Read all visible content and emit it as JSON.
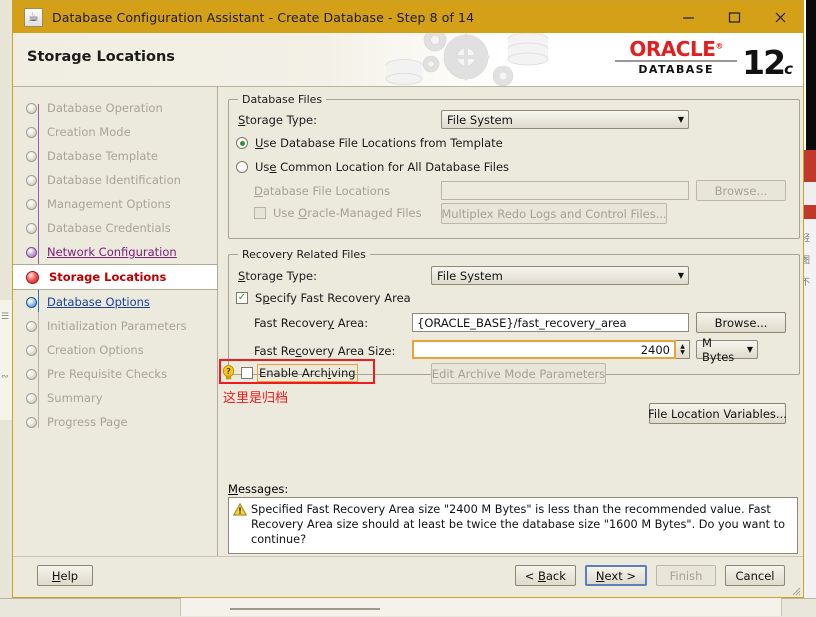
{
  "window": {
    "title": "Database Configuration Assistant - Create Database - Step 8 of 14",
    "app_icon": "java-coffee-cup-icon",
    "minimize_label": "─",
    "maximize_label": "□",
    "close_label": "✕"
  },
  "banner": {
    "page_title": "Storage Locations",
    "brand": "ORACLE",
    "brand_reg": "®",
    "brand_sub": "DATABASE",
    "version_number": "12",
    "version_suffix": "c"
  },
  "sidebar": {
    "items": [
      {
        "label": "Database Operation",
        "state": "pending"
      },
      {
        "label": "Creation Mode",
        "state": "pending"
      },
      {
        "label": "Database Template",
        "state": "pending"
      },
      {
        "label": "Database Identification",
        "state": "pending"
      },
      {
        "label": "Management Options",
        "state": "pending"
      },
      {
        "label": "Database Credentials",
        "state": "pending"
      },
      {
        "label": "Network Configuration",
        "state": "done"
      },
      {
        "label": "Storage Locations",
        "state": "current"
      },
      {
        "label": "Database Options",
        "state": "next"
      },
      {
        "label": "Initialization Parameters",
        "state": "pending"
      },
      {
        "label": "Creation Options",
        "state": "pending"
      },
      {
        "label": "Pre Requisite Checks",
        "state": "pending"
      },
      {
        "label": "Summary",
        "state": "pending"
      },
      {
        "label": "Progress Page",
        "state": "pending"
      }
    ]
  },
  "database_files": {
    "legend": "Database Files",
    "storage_type_label": "Storage Type:",
    "storage_type_value": "File System",
    "radio_template": "Use Database File Locations from Template",
    "radio_common": "Use Common Location for All Database Files",
    "file_locations_label": "Database File Locations",
    "file_locations_value": "",
    "browse_label": "Browse...",
    "omf_label": "Use Oracle-Managed Files",
    "multiplex_label": "Multiplex Redo Logs and Control Files..."
  },
  "recovery_files": {
    "legend": "Recovery Related Files",
    "storage_type_label": "Storage Type:",
    "storage_type_value": "File System",
    "specify_fra_label": "Specify Fast Recovery Area",
    "fra_label": "Fast Recovery Area:",
    "fra_value": "{ORACLE_BASE}/fast_recovery_area",
    "browse_label": "Browse...",
    "fra_size_label": "Fast Recovery Area Size:",
    "fra_size_value": "2400",
    "fra_size_unit": "M Bytes",
    "enable_archiving_label": "Enable Archiving",
    "edit_archive_label": "Edit Archive Mode Parameters"
  },
  "annotation": {
    "chinese_note": "这里是归档",
    "highlight_color": "#ee1c1c"
  },
  "file_location_variables_label": "File Location Variables...",
  "messages": {
    "label": "Messages:",
    "icon": "warning-icon",
    "text": "Specified Fast Recovery Area size \"2400 M Bytes\" is less than the recommended value. Fast Recovery Area size should at least be twice the database size \"1600 M Bytes\". Do you want to continue?"
  },
  "footer": {
    "help": "Help",
    "back": "< Back",
    "next": "Next >",
    "finish": "Finish",
    "cancel": "Cancel"
  },
  "background": {
    "right_char1": "轻",
    "right_char2": "图",
    "right_char3": "不"
  }
}
